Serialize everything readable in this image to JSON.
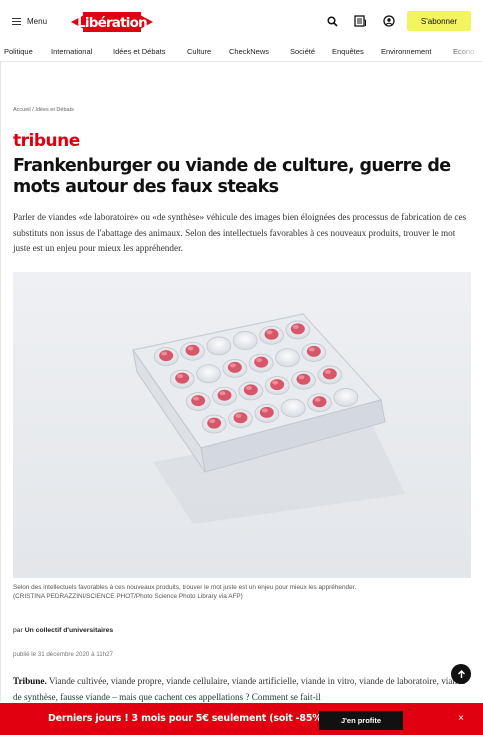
{
  "header": {
    "menu_label": "Menu",
    "logo_text": "Libération",
    "subscribe_label": "S'abonner",
    "icons": [
      "search-icon",
      "newspaper-icon",
      "account-icon"
    ]
  },
  "nav": {
    "items": [
      "Politique",
      "International",
      "Idées et Débats",
      "Culture",
      "CheckNews",
      "Société",
      "Enquêtes",
      "Environnement",
      "Econo"
    ]
  },
  "breadcrumb": {
    "home": "Accueil",
    "separator": " / ",
    "section": "Idées et Débats"
  },
  "article": {
    "kicker": "tribune",
    "title": "Frankenburger ou viande de culture, guerre de mots autour des faux steaks",
    "lede": "Parler de viandes «de laboratoire» ou «de synthèse» véhicule des images bien éloignées des processus de fabrication de ces substituts non issus de l'abattage des animaux. Selon des intellectuels favorables à ces nouveaux produits, trouver le mot juste est un enjeu pour mieux les appréhender.",
    "caption": "Selon des intellectuels favorables à ces nouveaux produits, trouver le mot juste est un enjeu pour mieux les appréhender.",
    "credit": "(CRISTINA PEDRAZZINI/SCIENCE PHOT/Photo Science Photo Library via AFP)",
    "byline_prefix": "par ",
    "byline_author": "Un collectif d'universitaires",
    "published": "publié le 31 décembre 2020 à 11h27",
    "body_lead": "Tribune.",
    "body_text": " Viande cultivée, viande propre, viande cellulaire, viande artificielle, viande in vitro, viande de laboratoire, viande de synthèse, fausse viande – mais que cachent ces appellations ? Comment se fait-il"
  },
  "promo": {
    "text": "Derniers jours ! 3 mois pour 5€ seulement (soit -85%)",
    "button": "J'en profite",
    "close": "×"
  },
  "colors": {
    "brand_red": "#e1000f",
    "subscribe_yellow": "#f3f55e"
  }
}
